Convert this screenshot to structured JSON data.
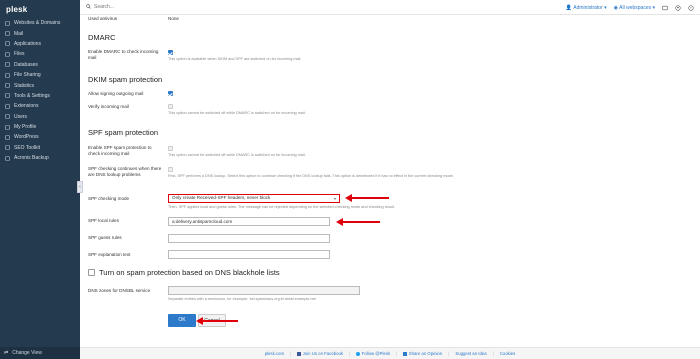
{
  "app": {
    "logo": "plesk"
  },
  "sidebar": {
    "items": [
      {
        "label": "Websites & Domains",
        "icon": "globe-icon"
      },
      {
        "label": "Mail",
        "icon": "mail-icon"
      },
      {
        "label": "Applications",
        "icon": "applications-icon"
      },
      {
        "label": "Files",
        "icon": "folder-icon"
      },
      {
        "label": "Databases",
        "icon": "database-icon"
      },
      {
        "label": "File Sharing",
        "icon": "share-icon"
      },
      {
        "label": "Statistics",
        "icon": "stats-icon"
      },
      {
        "label": "Tools & Settings",
        "icon": "tools-icon"
      },
      {
        "label": "Extensions",
        "icon": "extensions-icon"
      },
      {
        "label": "Users",
        "icon": "users-icon"
      },
      {
        "label": "My Profile",
        "icon": "profile-icon"
      },
      {
        "label": "WordPress",
        "icon": "wordpress-icon"
      },
      {
        "label": "SEO Toolkit",
        "icon": "seo-icon"
      },
      {
        "label": "Acronis Backup",
        "icon": "backup-icon"
      }
    ],
    "change_view": "Change View"
  },
  "topbar": {
    "search_placeholder": "Search...",
    "user": "Administrator ▾",
    "webspaces": "All webspaces ▾"
  },
  "form": {
    "used_antivirus_label": "Used antivirus",
    "used_antivirus_value": "None",
    "dmarc_title": "DMARC",
    "dmarc_check_label": "Enable DMARC to check incoming mail",
    "dmarc_hint": "This option is available when DKIM and SPF are switched on for incoming mail.",
    "dkim_title": "DKIM spam protection",
    "dkim_sign_label": "Allow signing outgoing mail",
    "dkim_verify_label": "Verify incoming mail",
    "dkim_verify_hint": "This option cannot be switched off while DMARC is switched on for incoming mail.",
    "spf_title": "SPF spam protection",
    "spf_enable_label": "Enable SPF spam protection to check incoming mail",
    "spf_enable_hint": "This option cannot be switched off while DMARC is switched on for incoming mail.",
    "spf_continue_label": "SPF checking continues when there are DNS lookup problems",
    "spf_continue_hint": "First, SPF performs a DNS lookup. Select this option to continue checking if the DNS lookup fails. This option is deselected if it has no effect in the current checking mode.",
    "spf_mode_label": "SPF checking mode",
    "spf_mode_value": "Only create Received-SPF headers, never block",
    "spf_mode_hint": "Then, SPF applies local and guess rules. The message can be rejected depending on the selected checking mode and checking result.",
    "spf_local_label": "SPF local rules",
    "spf_local_value": "a:delivery.antispamcloud.com",
    "spf_guess_label": "SPF guess rules",
    "spf_guess_value": "",
    "spf_expl_label": "SPF explanation text",
    "spf_expl_value": "",
    "dnsbl_title": "Turn on spam protection based on DNS blackhole lists",
    "dnsbl_label": "DNS zones for DNSBL service",
    "dnsbl_value": "",
    "dnsbl_hint": "Separate entries with a semicolon, for example: 'sbl.spamhaus.org;bl.dnsbl.example.net'",
    "ok_label": "OK",
    "cancel_label": "Cancel"
  },
  "footer": {
    "links": [
      "plesk.com",
      "Join Us on Facebook",
      "Follow @Plesk",
      "Share an Opinion",
      "Suggest an Idea",
      "Cookies"
    ]
  },
  "colors": {
    "sidebar_bg": "#243a4e",
    "accent": "#2c7ac9",
    "annotation_red": "#e0000a"
  }
}
